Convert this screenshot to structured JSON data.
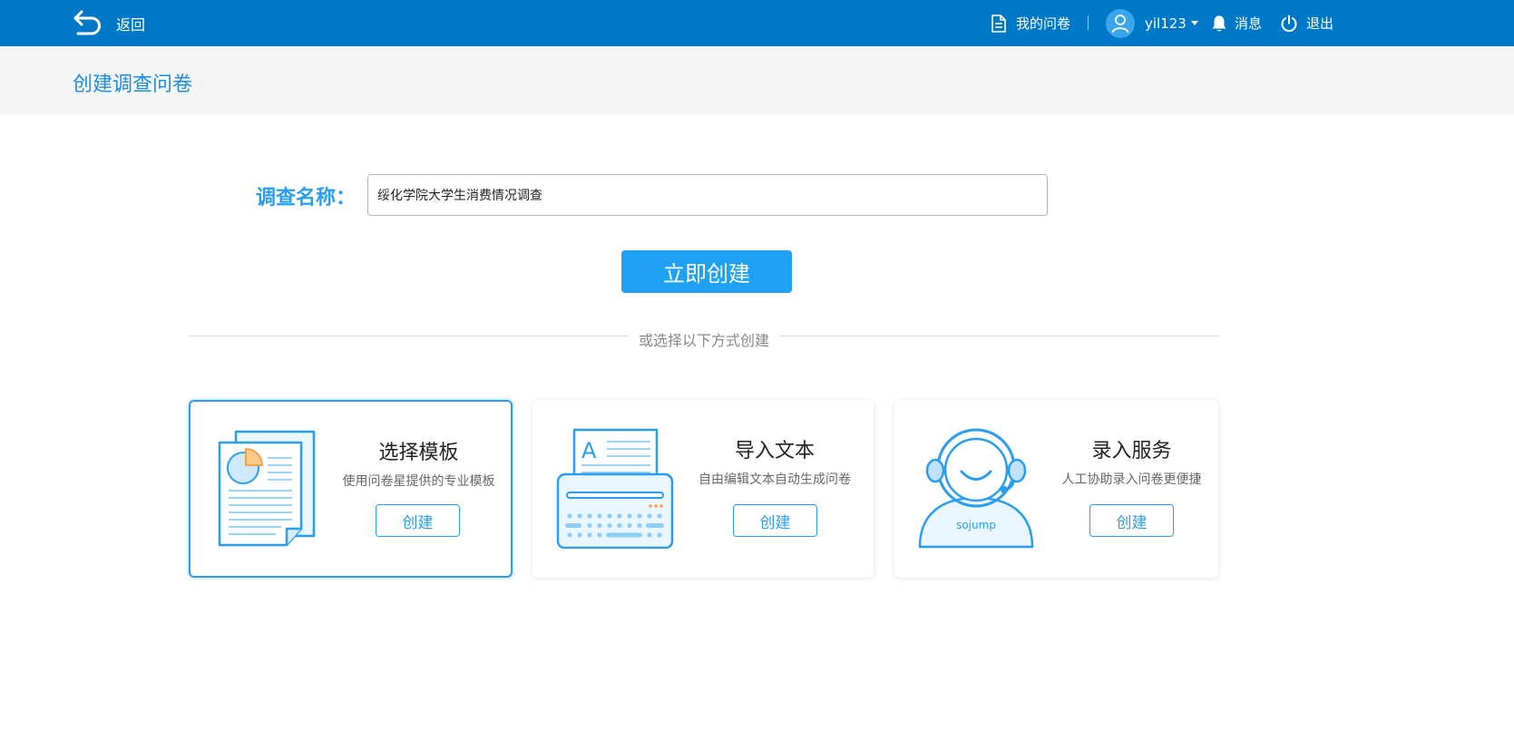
{
  "header": {
    "back_label": "返回",
    "my_surveys_label": "我的问卷",
    "username": "yil123",
    "messages_label": "消息",
    "logout_label": "退出"
  },
  "page": {
    "title": "创建调查问卷"
  },
  "form": {
    "name_label": "调查名称：",
    "name_value": "绥化学院大学生消费情况调查",
    "submit_label": "立即创建"
  },
  "alternatives": {
    "divider_text": "或选择以下方式创建",
    "cards": [
      {
        "title": "选择模板",
        "description": "使用问卷星提供的专业模板",
        "button_label": "创建",
        "icon": "template-document-icon",
        "selected": true
      },
      {
        "title": "导入文本",
        "description": "自由编辑文本自动生成问卷",
        "button_label": "创建",
        "icon": "typewriter-icon",
        "selected": false
      },
      {
        "title": "录入服务",
        "description": "人工协助录入问卷更便捷",
        "button_label": "创建",
        "icon": "customer-service-agent-icon",
        "selected": false,
        "illustration_text": "sojump"
      }
    ]
  },
  "colors": {
    "topbar": "#0078c8",
    "accent": "#1ea0f3",
    "title_blue": "#1a8fe0",
    "card_border_selected": "#2b9df0"
  }
}
